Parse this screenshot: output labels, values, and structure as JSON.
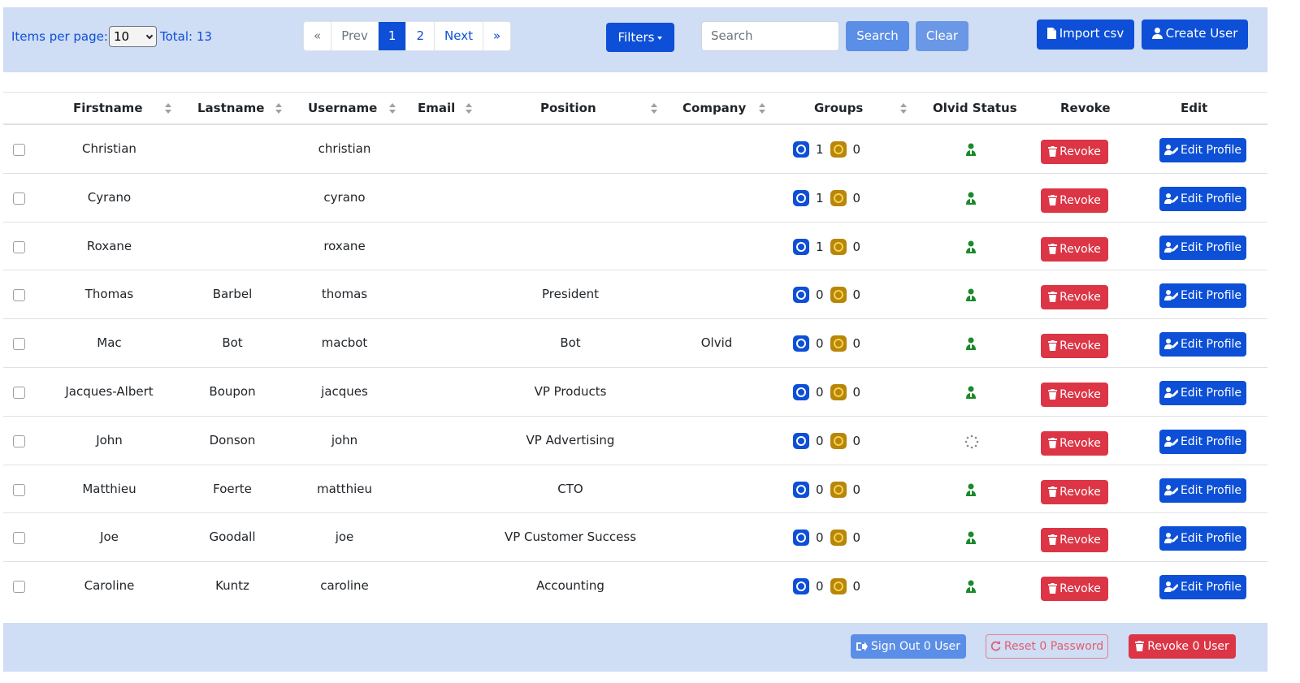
{
  "toolbar": {
    "items_per_page_label": "Items per page:",
    "items_per_page_value": "10",
    "total_label": "Total: 13",
    "pager": {
      "first": "«",
      "prev": "Prev",
      "page1": "1",
      "page2": "2",
      "next": "Next",
      "last": "»"
    },
    "filters_label": "Filters",
    "search_placeholder": "Search",
    "search_label": "Search",
    "clear_label": "Clear",
    "import_label": "Import csv",
    "create_label": "Create User"
  },
  "columns": [
    "Firstname",
    "Lastname",
    "Username",
    "Email",
    "Position",
    "Company",
    "Groups",
    "Olvid Status",
    "Revoke",
    "Edit"
  ],
  "row_actions": {
    "revoke_label": "Revoke",
    "edit_label": "Edit Profile"
  },
  "rows": [
    {
      "firstname": "Christian",
      "lastname": "",
      "username": "christian",
      "email": "",
      "position": "",
      "company": "",
      "groups_a": "1",
      "groups_b": "0",
      "status": "active"
    },
    {
      "firstname": "Cyrano",
      "lastname": "",
      "username": "cyrano",
      "email": "",
      "position": "",
      "company": "",
      "groups_a": "1",
      "groups_b": "0",
      "status": "active"
    },
    {
      "firstname": "Roxane",
      "lastname": "",
      "username": "roxane",
      "email": "",
      "position": "",
      "company": "",
      "groups_a": "1",
      "groups_b": "0",
      "status": "active"
    },
    {
      "firstname": "Thomas",
      "lastname": "Barbel",
      "username": "thomas",
      "email": "",
      "position": "President",
      "company": "",
      "groups_a": "0",
      "groups_b": "0",
      "status": "active"
    },
    {
      "firstname": "Mac",
      "lastname": "Bot",
      "username": "macbot",
      "email": "",
      "position": "Bot",
      "company": "Olvid",
      "groups_a": "0",
      "groups_b": "0",
      "status": "active"
    },
    {
      "firstname": "Jacques-Albert",
      "lastname": "Boupon",
      "username": "jacques",
      "email": "",
      "position": "VP Products",
      "company": "",
      "groups_a": "0",
      "groups_b": "0",
      "status": "active"
    },
    {
      "firstname": "John",
      "lastname": "Donson",
      "username": "john",
      "email": "",
      "position": "VP Advertising",
      "company": "",
      "groups_a": "0",
      "groups_b": "0",
      "status": "pending"
    },
    {
      "firstname": "Matthieu",
      "lastname": "Foerte",
      "username": "matthieu",
      "email": "",
      "position": "CTO",
      "company": "",
      "groups_a": "0",
      "groups_b": "0",
      "status": "active"
    },
    {
      "firstname": "Joe",
      "lastname": "Goodall",
      "username": "joe",
      "email": "",
      "position": "VP Customer Success",
      "company": "",
      "groups_a": "0",
      "groups_b": "0",
      "status": "active"
    },
    {
      "firstname": "Caroline",
      "lastname": "Kuntz",
      "username": "caroline",
      "email": "",
      "position": "Accounting",
      "company": "",
      "groups_a": "0",
      "groups_b": "0",
      "status": "active"
    }
  ],
  "footer": {
    "signout_label": "Sign Out 0 User",
    "reset_label": "Reset 0 Password",
    "revoke_label": "Revoke 0 User"
  },
  "colors": {
    "primary": "#0d4fd6",
    "danger": "#dc3545",
    "panel": "#cfddf5",
    "status_active": "#1a8a2a"
  }
}
